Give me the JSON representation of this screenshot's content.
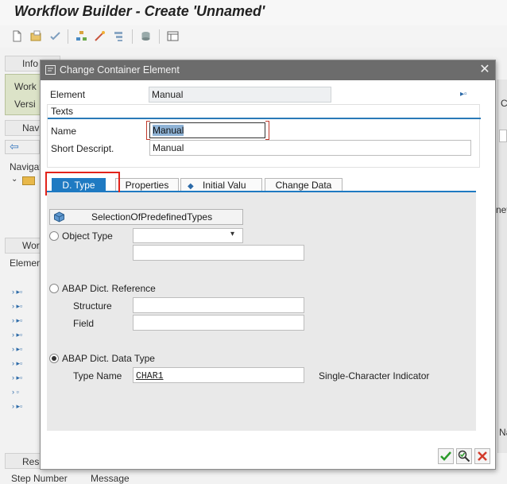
{
  "app": {
    "title": "Workflow Builder - Create 'Unnamed'"
  },
  "background": {
    "info_tab": "Info",
    "workflow_label": "Work",
    "version_label": "Versi",
    "navigation_tab": "Nav",
    "navigation_area": "Navigat",
    "workflow_section": "Wor",
    "elements_label": "Elemen",
    "results_tab": "Resu",
    "step_number_col": "Step Number",
    "message_col": "Message",
    "right_fragment_nev": "nev",
    "right_fragment_c": "C",
    "right_fragment_na": "Na"
  },
  "dialog": {
    "title": "Change Container Element",
    "element_label": "Element",
    "element_value": "Manual",
    "texts_header": "Texts",
    "name_label": "Name",
    "name_value": "Manual",
    "short_descript_label": "Short Descript.",
    "short_descript_value": "Manual",
    "tabs": [
      {
        "label": "D. Type",
        "active": true
      },
      {
        "label": "Properties",
        "active": false
      },
      {
        "label": "Initial Valu",
        "active": false
      },
      {
        "label": "Change Data",
        "active": false
      }
    ],
    "selection_button": "SelectionOfPredefinedTypes",
    "object_type_label": "Object Type",
    "object_type_value": "",
    "abap_dict_ref_label": "ABAP Dict. Reference",
    "structure_label": "Structure",
    "structure_value": "",
    "field_label": "Field",
    "field_value": "",
    "abap_dict_data_type_label": "ABAP Dict. Data Type",
    "type_name_label": "Type Name",
    "type_name_value": "CHAR1",
    "type_description": "Single-Character Indicator",
    "selected_radio": "abap_dict_data_type"
  },
  "colors": {
    "accent": "#1f7ac2",
    "highlight_frame": "#e2231a",
    "titlebar": "#6c6c6c",
    "confirm": "#2a9a2a",
    "cancel": "#d23b2b"
  }
}
